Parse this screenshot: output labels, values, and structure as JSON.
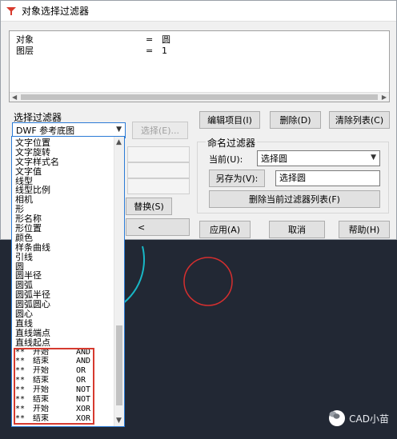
{
  "window": {
    "title": "对象选择过滤器"
  },
  "filter_list": {
    "rows": [
      {
        "prop": "对象",
        "op": "=",
        "value": "圆"
      },
      {
        "prop": "图层",
        "op": "=",
        "value": "1"
      }
    ]
  },
  "select_filter": {
    "label": "选择过滤器",
    "combo_value": "DWF 参考底图",
    "select_button": "选择(E)...",
    "replace_button": "替换(S)",
    "add_button": "<"
  },
  "toolbar": {
    "edit_item": "编辑项目(I)",
    "delete": "删除(D)",
    "clear_list": "清除列表(C)"
  },
  "named_filter": {
    "label": "命名过滤器",
    "current_label": "当前(U):",
    "current_value": "选择圆",
    "save_as_button": "另存为(V):",
    "save_as_value": "选择圆",
    "delete_current": "删除当前过滤器列表(F)"
  },
  "footer": {
    "apply": "应用(A)",
    "cancel": "取消",
    "help": "帮助(H)"
  },
  "dropdown": {
    "items": [
      "文字位置",
      "文字旋转",
      "文字样式名",
      "文字值",
      "线型",
      "线型比例",
      "相机",
      "形",
      "形名称",
      "形位置",
      "颜色",
      "样条曲线",
      "引线",
      "圆",
      "圆半径",
      "圆弧",
      "圆弧半径",
      "圆弧圆心",
      "圆心",
      "直线",
      "直线端点",
      "直线起点"
    ],
    "logic_items": [
      {
        "prefix": "**",
        "text": "开始",
        "op": "AND"
      },
      {
        "prefix": "**",
        "text": "结束",
        "op": "AND"
      },
      {
        "prefix": "**",
        "text": "开始",
        "op": "OR"
      },
      {
        "prefix": "**",
        "text": "结束",
        "op": "OR"
      },
      {
        "prefix": "**",
        "text": "开始",
        "op": "NOT"
      },
      {
        "prefix": "**",
        "text": "结束",
        "op": "NOT"
      },
      {
        "prefix": "**",
        "text": "开始",
        "op": "XOR"
      },
      {
        "prefix": "**",
        "text": "结束",
        "op": "XOR"
      }
    ]
  },
  "watermark": {
    "text": "CAD小苗"
  },
  "colors": {
    "circle_red": "#d62f2f",
    "arc_cyan": "#18b7c6",
    "highlight": "#d63a2f"
  }
}
